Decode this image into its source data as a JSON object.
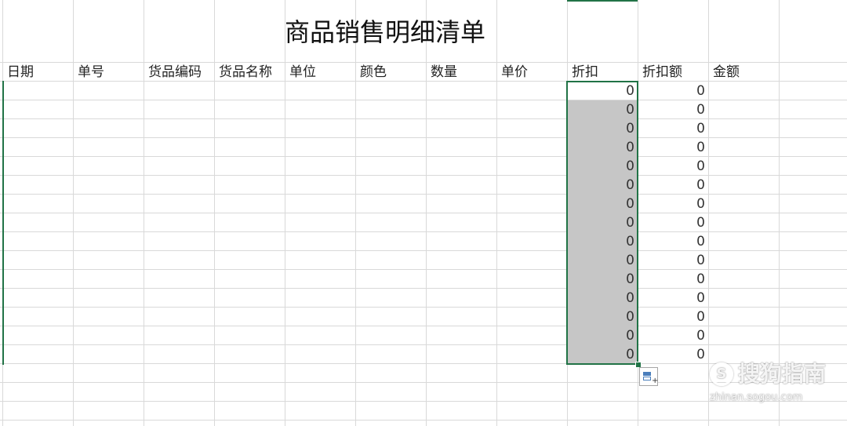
{
  "sheet": {
    "title": "商品销售明细清单",
    "headers": [
      "日期",
      "单号",
      "货品编码",
      "货品名称",
      "单位",
      "颜色",
      "数量",
      "单价",
      "折扣",
      "折扣额",
      "金额"
    ],
    "discount_values": [
      "0",
      "0",
      "0",
      "0",
      "0",
      "0",
      "0",
      "0",
      "0",
      "0",
      "0",
      "0",
      "0",
      "0",
      "0"
    ],
    "discount_amount_values": [
      "0",
      "0",
      "0",
      "0",
      "0",
      "0",
      "0",
      "0",
      "0",
      "0",
      "0",
      "0",
      "0",
      "0",
      "0"
    ]
  },
  "colors": {
    "selection_border": "#217346",
    "selection_fill": "#c6c6c6",
    "gridline": "#d9d9d9"
  },
  "watermark": {
    "logo_letter": "S",
    "text": "搜狗指南",
    "url": "zhinan.sogou.com"
  },
  "autofill_icon": "auto-fill-options-icon"
}
